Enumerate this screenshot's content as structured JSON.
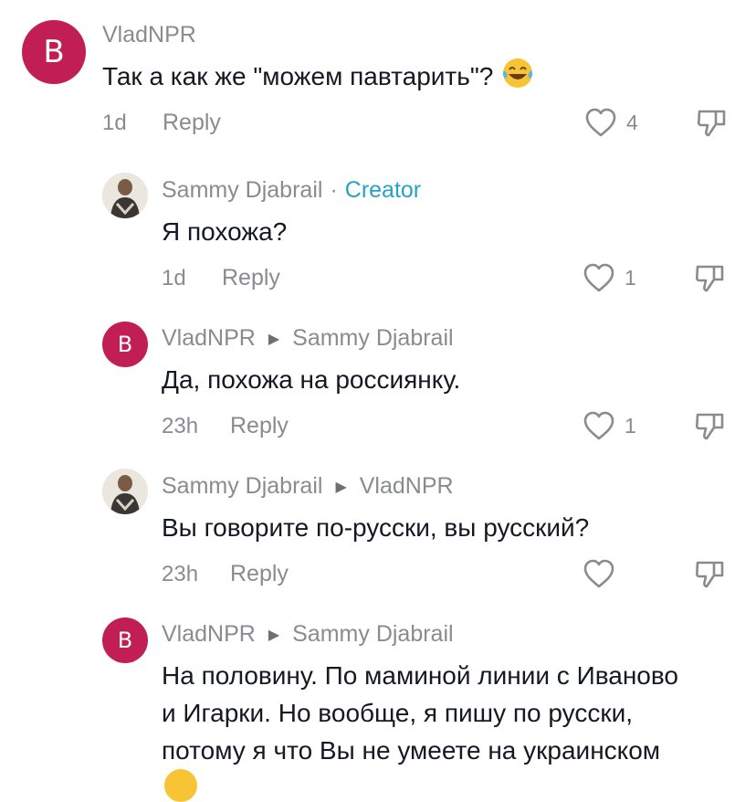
{
  "comments": [
    {
      "author": "VladNPR",
      "avatar_letter": "B",
      "text": "Так а как же \"можем павтарить\"?",
      "time": "1d",
      "reply_label": "Reply",
      "likes": "4"
    },
    {
      "author": "Sammy Djabrail",
      "separator": "·",
      "badge": "Creator",
      "text": "Я похожа?",
      "time": "1d",
      "reply_label": "Reply",
      "likes": "1"
    },
    {
      "author": "VladNPR",
      "avatar_letter": "B",
      "reply_to": "Sammy Djabrail",
      "text": "Да, похожа на россиянку.",
      "time": "23h",
      "reply_label": "Reply",
      "likes": "1"
    },
    {
      "author": "Sammy Djabrail",
      "reply_to": "VladNPR",
      "text": "Вы говорите по-русски, вы русский?",
      "time": "23h",
      "reply_label": "Reply",
      "likes": ""
    },
    {
      "author": "VladNPR",
      "avatar_letter": "B",
      "reply_to": "Sammy Djabrail",
      "text_lines": [
        "На половину. По маминой линии с Иваново",
        "и Игарки. Но вообще, я пишу по русски,",
        "потому я что Вы не умеете на украинском"
      ]
    }
  ],
  "colors": {
    "avatar_bg": "#c11e55",
    "creator": "#29a0c8",
    "secondary_text": "#8a8b91"
  },
  "icons": {
    "like": "heart-outline-icon",
    "dislike": "thumbs-down-outline-icon",
    "reply_arrow": "triangle-right-icon",
    "emoji": "tears-of-joy-emoji"
  }
}
